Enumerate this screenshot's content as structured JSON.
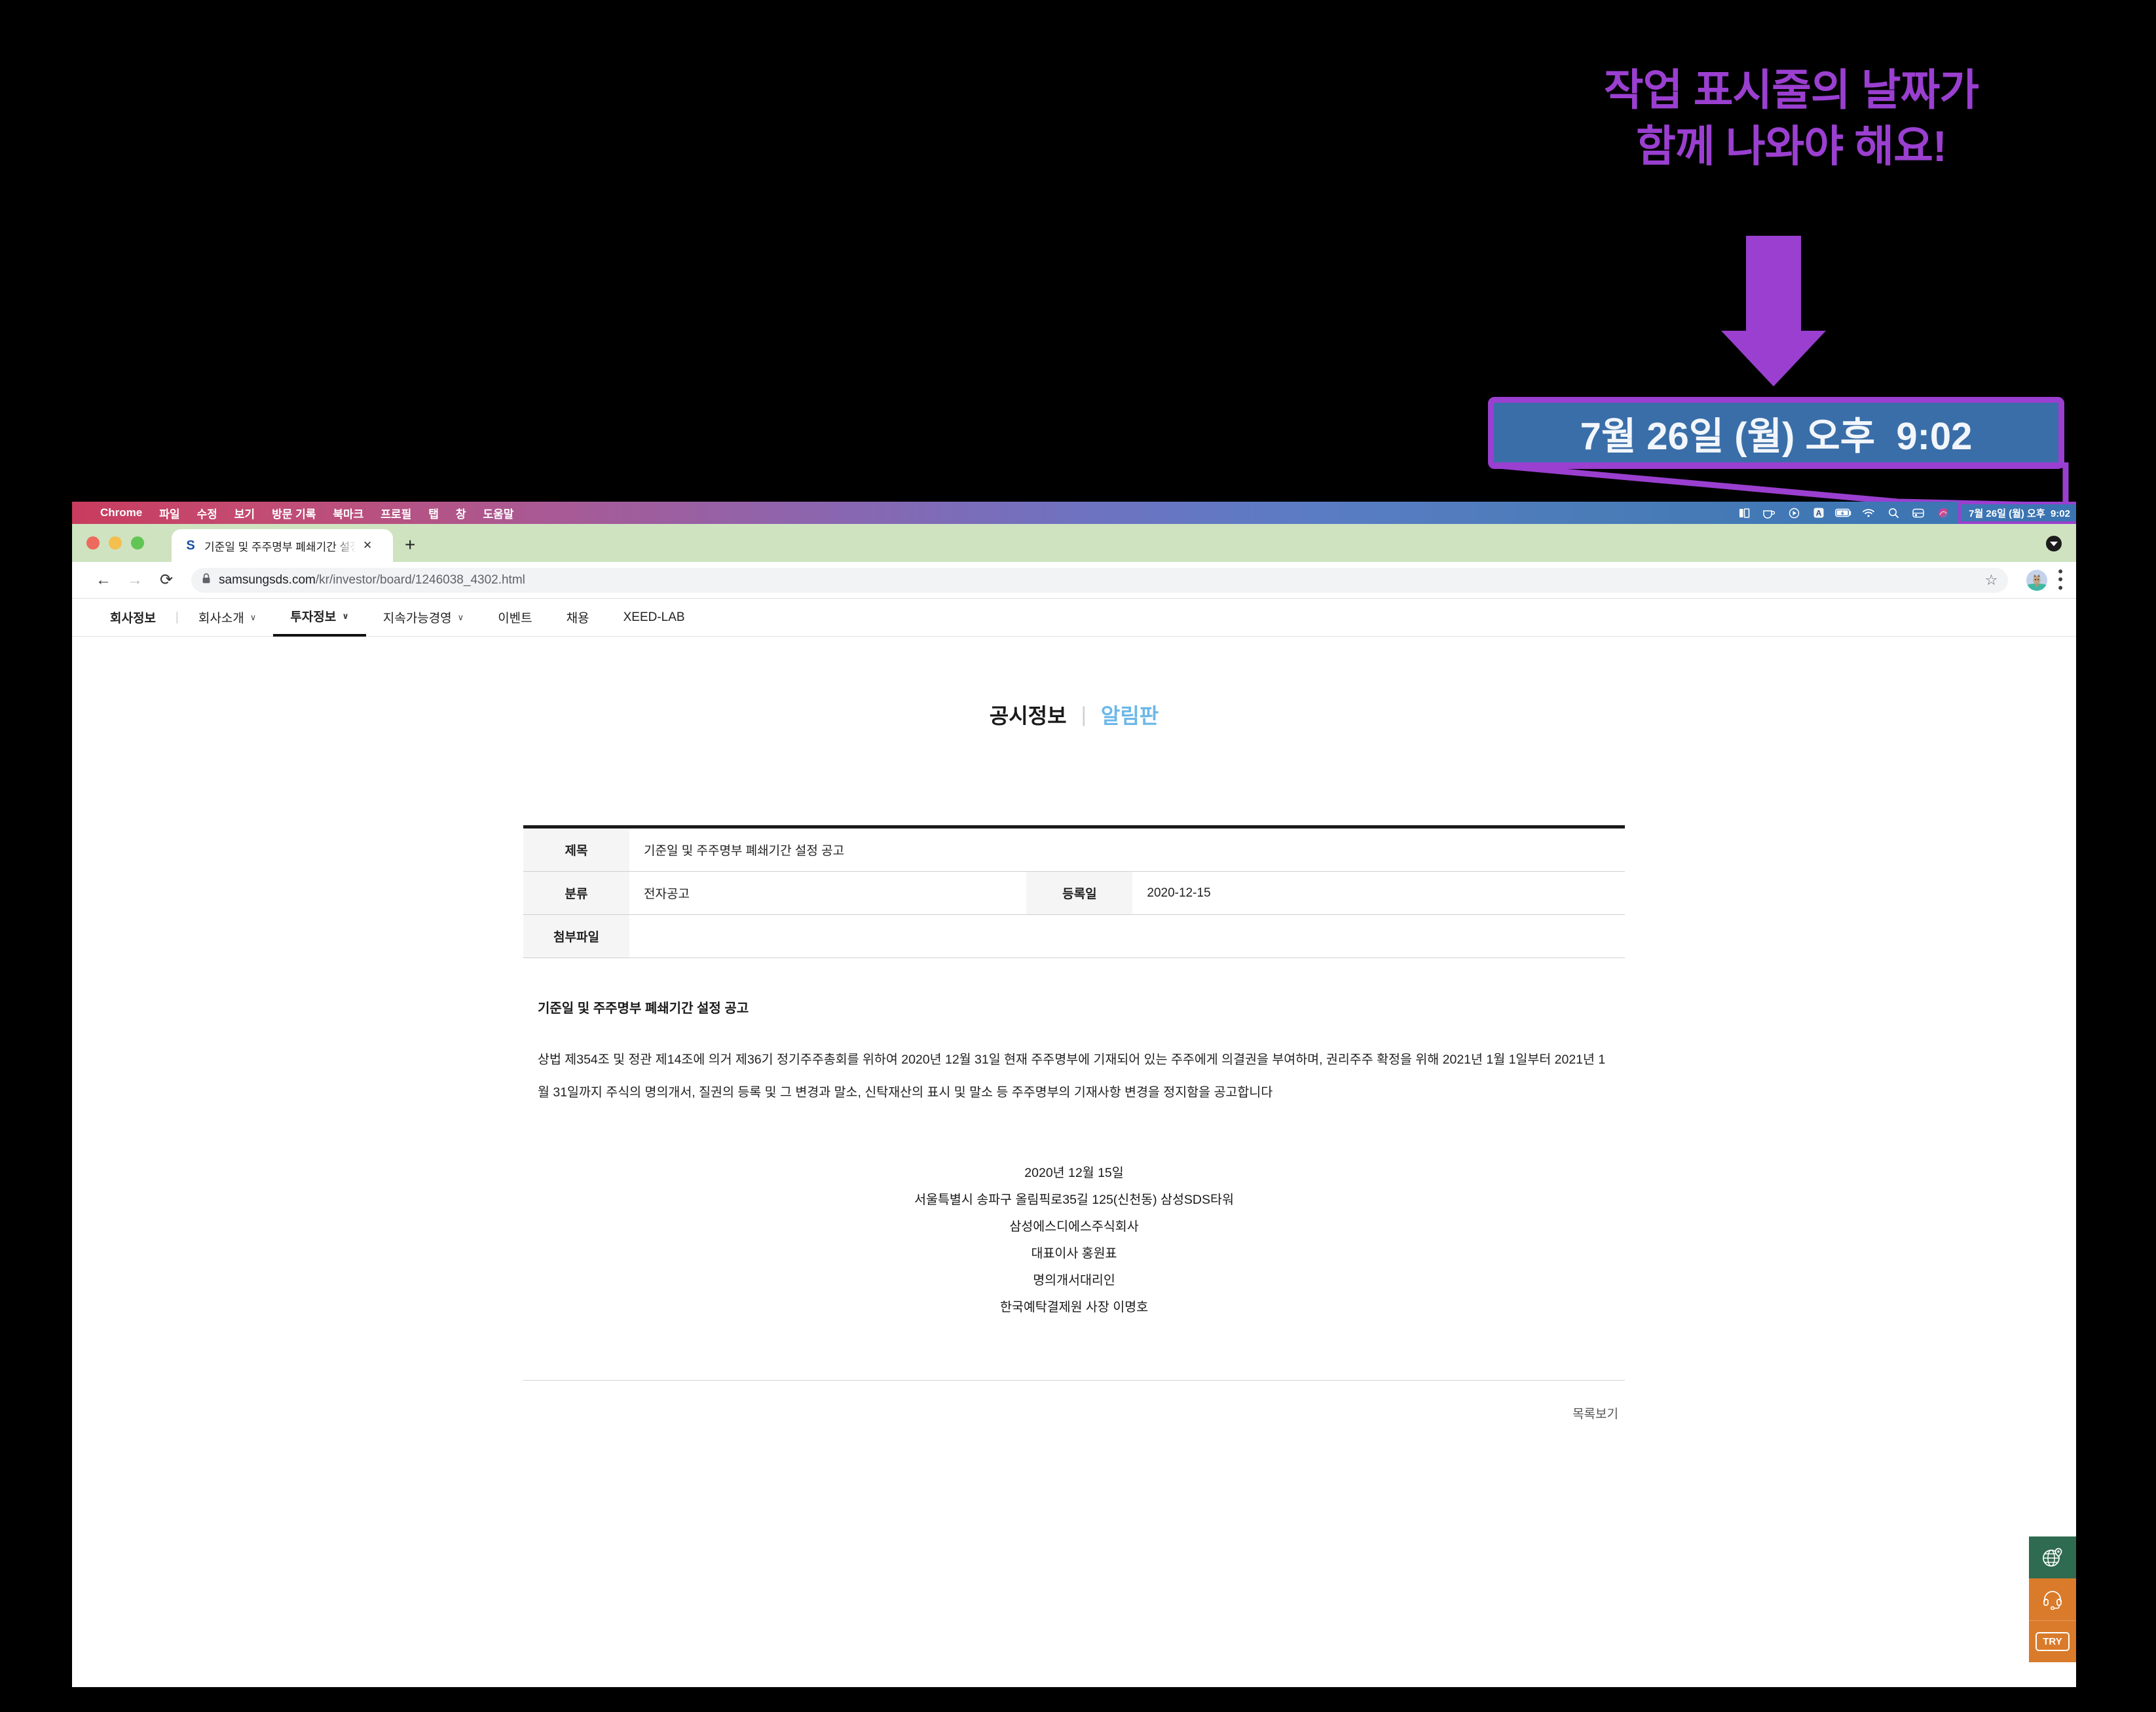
{
  "annotation": {
    "text": "작업 표시줄의 날짜가\n함께 나와야 해요!",
    "arrow_icon": "down-arrow-icon",
    "color": "#9a3fd0",
    "callout_value": "7월 26일 (월) 오후  9:02",
    "callout_bg": "#3a6ea8"
  },
  "menubar": {
    "apple_logo": "",
    "app_name": "Chrome",
    "items": [
      "파일",
      "수정",
      "보기",
      "방문 기록",
      "북마크",
      "프로필",
      "탭",
      "창",
      "도움말"
    ],
    "status_icons": [
      {
        "name": "split-view-icon",
        "glyph": "▐▌"
      },
      {
        "name": "amphetamine-coffee-icon",
        "glyph": "☕"
      },
      {
        "name": "play-circle-icon",
        "glyph": "⊙"
      },
      {
        "name": "input-source-a-icon",
        "glyph": "A"
      },
      {
        "name": "battery-charging-icon",
        "glyph": "🔋"
      },
      {
        "name": "wifi-icon",
        "glyph": "⌃"
      },
      {
        "name": "spotlight-search-icon",
        "glyph": "⌕"
      },
      {
        "name": "control-center-icon",
        "glyph": "▤"
      },
      {
        "name": "siri-icon",
        "glyph": "◍"
      }
    ],
    "clock": "7월 26일 (월) 오후  9:02",
    "highlight_color": "#9a3fd0"
  },
  "browser": {
    "traffic_lights": [
      "close",
      "minimize",
      "zoom"
    ],
    "tab": {
      "favicon": "S",
      "title": "기준일 및 주주명부 폐쇄기간 설정 공",
      "close_label": "✕"
    },
    "new_tab_label": "+",
    "toolbar": {
      "back_label": "←",
      "forward_label": "→",
      "reload_label": "⟳",
      "lock_icon": "lock-icon",
      "url_domain": "samsungsds.com",
      "url_path": "/kr/investor/board/1246038_4302.html",
      "bookmark_label": "☆",
      "avatar_name": "cat-avatar",
      "menu_label": "⋮"
    }
  },
  "site_nav": {
    "items": [
      {
        "label": "회사정보",
        "has_chevron": false,
        "active": false,
        "first": true
      },
      {
        "label": "회사소개",
        "has_chevron": true,
        "active": false
      },
      {
        "label": "투자정보",
        "has_chevron": true,
        "active": true
      },
      {
        "label": "지속가능경영",
        "has_chevron": true,
        "active": false
      },
      {
        "label": "이벤트",
        "has_chevron": false,
        "active": false
      },
      {
        "label": "채용",
        "has_chevron": false,
        "active": false
      },
      {
        "label": "XEED-LAB",
        "has_chevron": false,
        "active": false
      }
    ],
    "chevron_glyph": "∨",
    "divider_glyph": "|"
  },
  "page": {
    "heading_left": "공시정보",
    "heading_divider": "|",
    "heading_active": "알림판",
    "table": {
      "rows": [
        {
          "label": "제목",
          "value": "기준일 및 주주명부 폐쇄기간 설정 공고"
        },
        {
          "label": "분류",
          "value": "전자공고",
          "label2": "등록일",
          "value2": "2020-12-15"
        },
        {
          "label": "첨부파일",
          "value": ""
        }
      ]
    },
    "article_title": "기준일 및 주주명부 폐쇄기간 설정 공고",
    "article_body": "상법 제354조 및 정관 제14조에 의거 제36기 정기주주총회를 위하여 2020년 12월 31일 현재 주주명부에 기재되어 있는 주주에게 의결권을 부여하며, 권리주주 확정을 위해 2021년 1월 1일부터 2021년 1월 31일까지 주식의 명의개서, 질권의 등록 및 그 변경과 말소, 신탁재산의 표시 및 말소 등 주주명부의 기재사항 변경을 정지함을 공고합니다",
    "signature": [
      "2020년 12월 15일",
      "서울특별시 송파구 올림픽로35길 125(신천동) 삼성SDS타워",
      "삼성에스디에스주식회사",
      "대표이사 홍원표",
      "명의개서대리인",
      "한국예탁결제원 사장 이명호"
    ],
    "list_link": "목록보기"
  },
  "float_buttons": [
    {
      "name": "globe-location-icon",
      "bg": "#2f6b50"
    },
    {
      "name": "headset-icon",
      "bg": "#d97b2b"
    },
    {
      "name": "try-button",
      "label": "TRY",
      "bg": "#d97b2b"
    }
  ]
}
